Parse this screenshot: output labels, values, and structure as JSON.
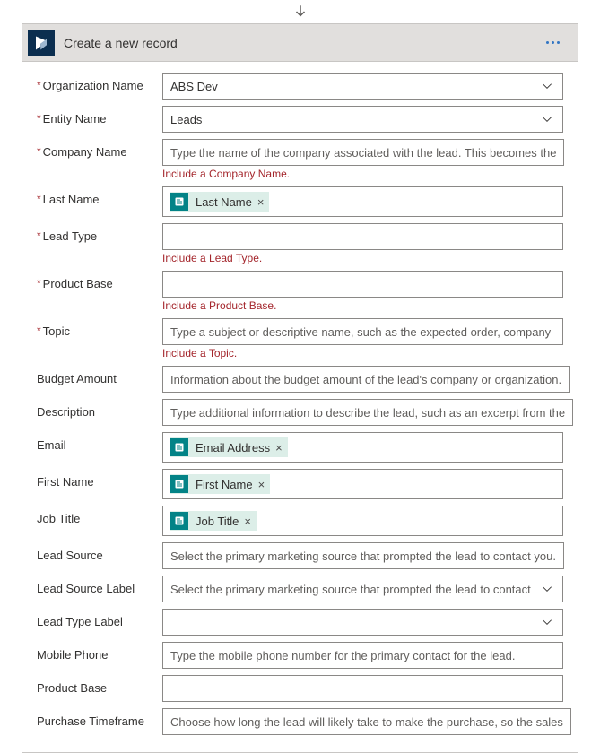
{
  "action": {
    "title": "Create a new record"
  },
  "fields": {
    "org": {
      "label": "Organization Name",
      "value": "ABS Dev"
    },
    "entity": {
      "label": "Entity Name",
      "value": "Leads"
    },
    "company": {
      "label": "Company Name",
      "placeholder": "Type the name of the company associated with the lead. This becomes the",
      "error": "Include a Company Name."
    },
    "lastname": {
      "label": "Last Name",
      "token": "Last Name"
    },
    "leadtype": {
      "label": "Lead Type",
      "error": "Include a Lead Type."
    },
    "productbase": {
      "label": "Product Base",
      "error": "Include a Product Base."
    },
    "topic": {
      "label": "Topic",
      "placeholder": "Type a subject or descriptive name, such as the expected order, company",
      "error": "Include a Topic."
    },
    "budget": {
      "label": "Budget Amount",
      "placeholder": "Information about the budget amount of the lead's company or organization."
    },
    "description": {
      "label": "Description",
      "placeholder": "Type additional information to describe the lead, such as an excerpt from the"
    },
    "email": {
      "label": "Email",
      "token": "Email Address"
    },
    "firstname": {
      "label": "First Name",
      "token": "First Name"
    },
    "jobtitle": {
      "label": "Job Title",
      "token": "Job Title"
    },
    "leadsource": {
      "label": "Lead Source",
      "placeholder": "Select the primary marketing source that prompted the lead to contact you."
    },
    "leadsourcelabel": {
      "label": "Lead Source Label",
      "placeholder": "Select the primary marketing source that prompted the lead to contact"
    },
    "leadtypelabel": {
      "label": "Lead Type Label"
    },
    "mobile": {
      "label": "Mobile Phone",
      "placeholder": "Type the mobile phone number for the primary contact for the lead."
    },
    "productbase2": {
      "label": "Product Base"
    },
    "purchase": {
      "label": "Purchase Timeframe",
      "placeholder": "Choose how long the lead will likely take to make the purchase, so the sales"
    }
  },
  "icons": {
    "removeToken": "×"
  }
}
